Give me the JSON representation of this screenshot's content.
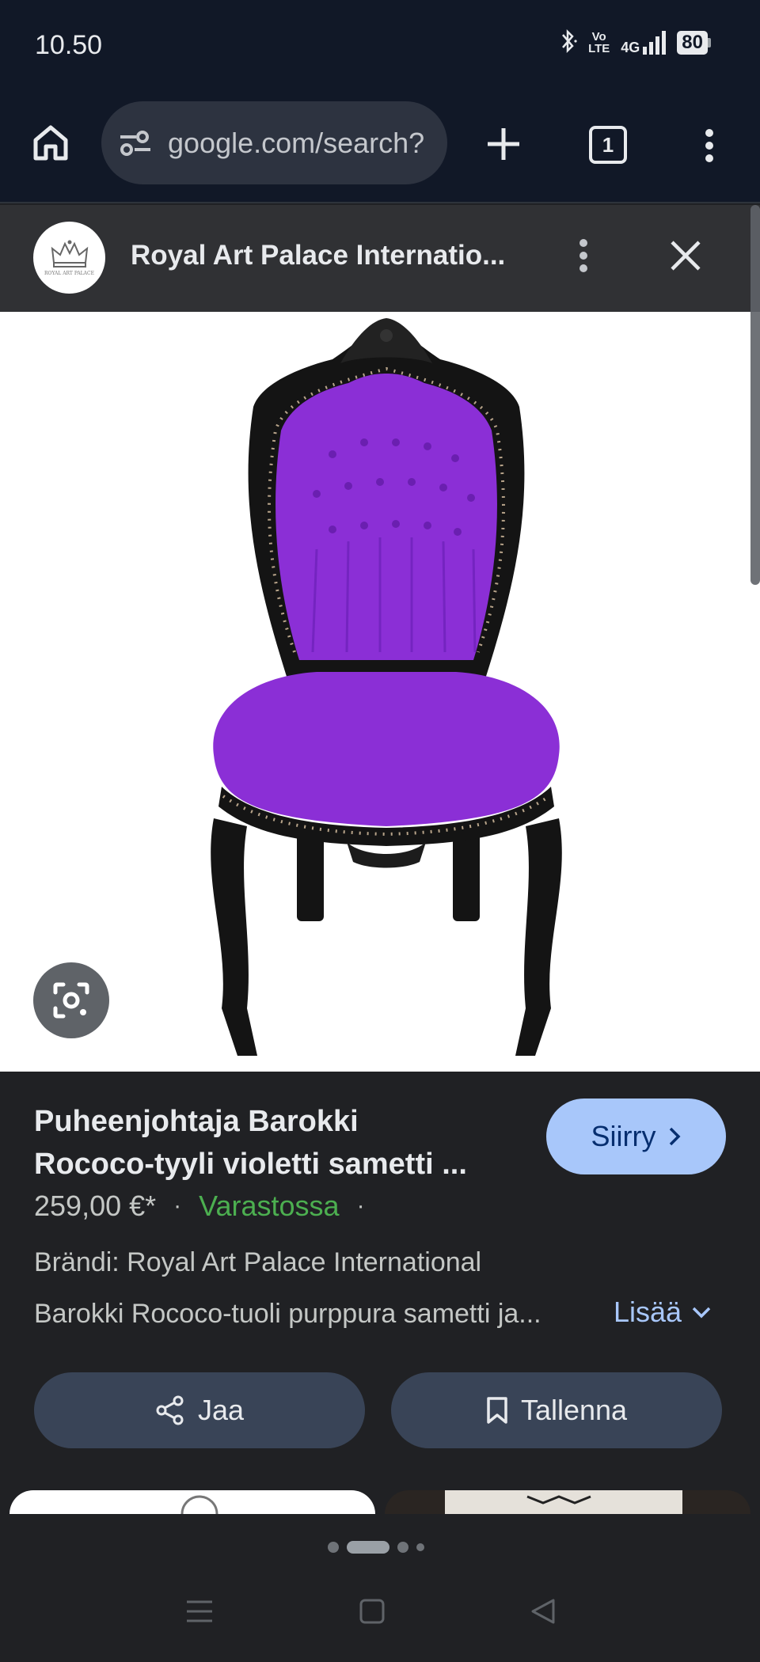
{
  "status_bar": {
    "time": "10.50",
    "bluetooth_icon": "bluetooth-icon",
    "volte": [
      "Vo",
      "LTE"
    ],
    "network": "4G",
    "battery": "80"
  },
  "browser": {
    "url": "google.com/search?",
    "tab_count": "1",
    "icons": {
      "home": "home-icon",
      "site_info": "site-settings-icon",
      "new_tab": "plus-icon",
      "menu": "more-vert-icon"
    }
  },
  "source": {
    "name": "Royal Art Palace Internatio...",
    "logo_caption": "ROYAL ART PALACE"
  },
  "product": {
    "title_line1": "Puheenjohtaja Barokki",
    "title_line2": "Rococo-tyyli violetti sametti ...",
    "go_label": "Siirry",
    "price": "259,00 €*",
    "stock": "Varastossa",
    "brand": "Brändi: Royal Art Palace International",
    "description": "Barokki Rococo-tuoli purppura sametti ja...",
    "more_label": "Lisää",
    "share_label": "Jaa",
    "save_label": "Tallenna"
  },
  "colors": {
    "accent": "#a8c7fa",
    "in_stock": "#4caf50",
    "chair_velvet": "#8b2fd6",
    "chair_frame": "#141414"
  }
}
